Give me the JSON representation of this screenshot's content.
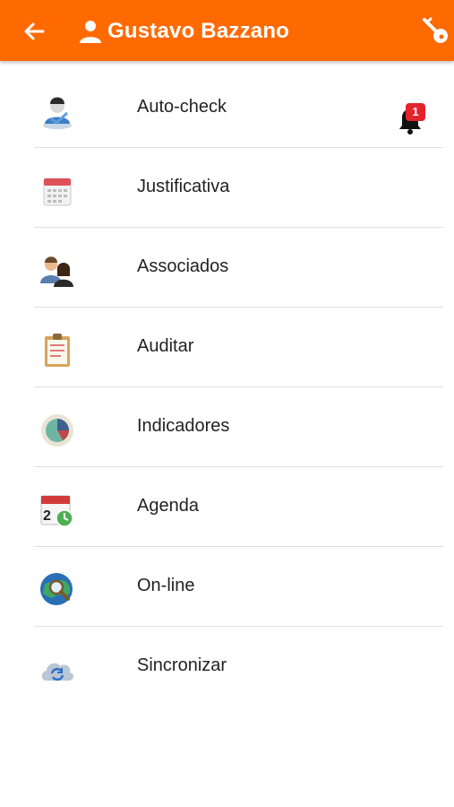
{
  "header": {
    "title": "Gustavo Bazzano",
    "back_icon": "arrow-left-icon",
    "user_icon": "person-icon",
    "action_icon": "key-icon",
    "background_color": "#ff6a00"
  },
  "menu": {
    "items": [
      {
        "label": "Auto-check",
        "icon": "user-check-icon"
      },
      {
        "label": "Justificativa",
        "icon": "calendar-icon",
        "notification_count": "1"
      },
      {
        "label": "Associados",
        "icon": "people-icon"
      },
      {
        "label": "Auditar",
        "icon": "clipboard-icon"
      },
      {
        "label": "Indicadores",
        "icon": "pie-chart-icon"
      },
      {
        "label": "Agenda",
        "icon": "agenda-calendar-icon"
      },
      {
        "label": "On-line",
        "icon": "globe-search-icon"
      },
      {
        "label": "Sincronizar",
        "icon": "cloud-sync-icon"
      }
    ]
  }
}
